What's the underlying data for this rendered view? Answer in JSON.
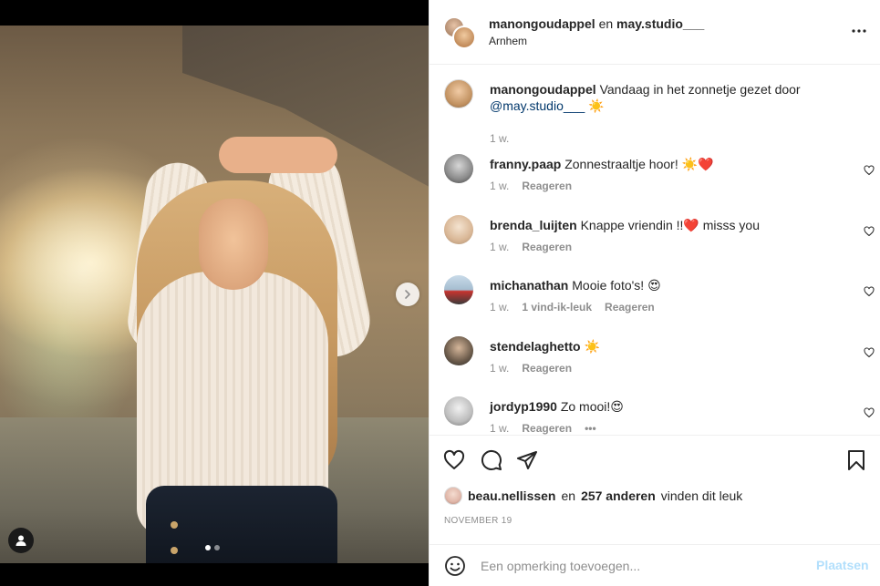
{
  "header": {
    "user1": "manongoudappel",
    "joiner": "en",
    "user2": "may.studio___",
    "location": "Arnhem",
    "more_icon": "more-horizontal-icon"
  },
  "caption": {
    "username": "manongoudappel",
    "text": "Vandaag in het zonnetje gezet door",
    "mention": "@may.studio___",
    "emoji": "☀️",
    "time": "1 w."
  },
  "comments": [
    {
      "username": "franny.paap",
      "text": "Zonnestraaltje hoor! ☀️❤️",
      "time": "1 w.",
      "reply": "Reageren",
      "likes": ""
    },
    {
      "username": "brenda_luijten",
      "text": "Knappe vriendin !!❤️ misss you",
      "time": "1 w.",
      "reply": "Reageren",
      "likes": ""
    },
    {
      "username": "michanathan",
      "text": "Mooie foto's! 😍",
      "time": "1 w.",
      "reply": "Reageren",
      "likes": "1 vind-ik-leuk"
    },
    {
      "username": "stendelaghetto",
      "text": "☀️",
      "time": "1 w.",
      "reply": "Reageren",
      "likes": ""
    },
    {
      "username": "jordyp1990",
      "text": "Zo mooi!😍",
      "time": "1 w.",
      "reply": "Reageren",
      "likes": ""
    }
  ],
  "load_more": "•••",
  "likes": {
    "user": "beau.nellissen",
    "joiner": "en",
    "others": "257 anderen",
    "suffix": "vinden dit leuk"
  },
  "date": "NOVEMBER 19",
  "add_comment": {
    "placeholder": "Een opmerking toevoegen...",
    "post_label": "Plaatsen"
  },
  "media": {
    "carousel_index": 1,
    "carousel_total": 2
  },
  "colors": {
    "text": "#262626",
    "muted": "#8e8e8e",
    "link": "#00376b",
    "post_button_disabled": "#b2dffc",
    "border": "#efefef"
  }
}
